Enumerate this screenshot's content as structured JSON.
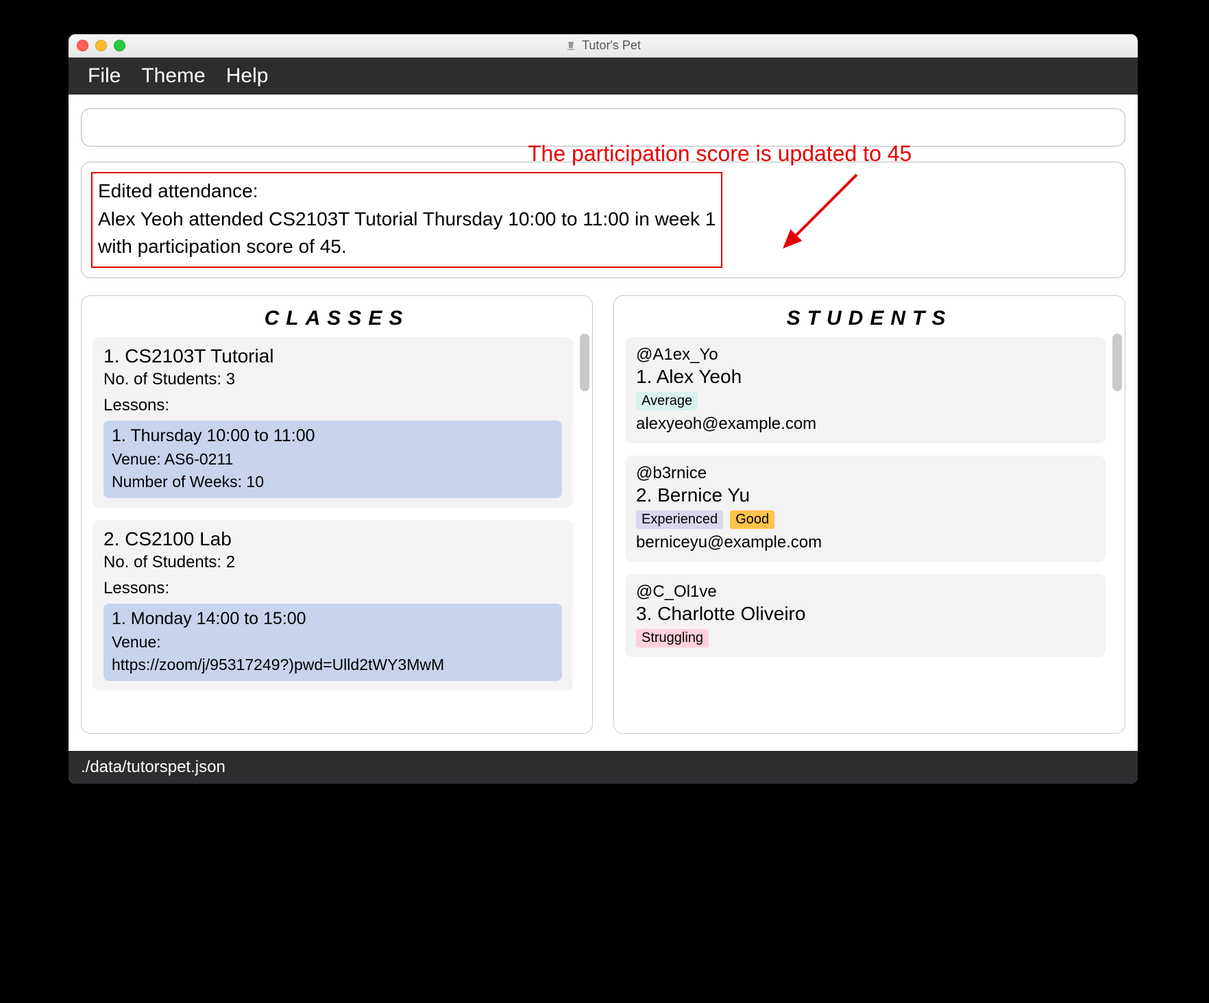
{
  "window": {
    "title": "Tutor's Pet"
  },
  "menubar": {
    "file": "File",
    "theme": "Theme",
    "help": "Help"
  },
  "command": {
    "value": ""
  },
  "result": {
    "line1": "Edited attendance:",
    "line2": "Alex Yeoh attended CS2103T Tutorial Thursday 10:00 to 11:00 in week 1",
    "line3": "with participation score of 45."
  },
  "annotation": {
    "text": "The participation score is updated to 45"
  },
  "panels": {
    "classes_header": "CLASSES",
    "students_header": "STUDENTS"
  },
  "classes": [
    {
      "title": "1.  CS2103T Tutorial",
      "students_line": "No. of Students:  3",
      "lessons_label": "Lessons:",
      "lessons": [
        {
          "time": "1. Thursday 10:00 to 11:00",
          "venue": "Venue: AS6-0211",
          "weeks": "Number of Weeks: 10"
        }
      ]
    },
    {
      "title": "2.  CS2100 Lab",
      "students_line": "No. of Students:  2",
      "lessons_label": "Lessons:",
      "lessons": [
        {
          "time": "1. Monday 14:00 to 15:00",
          "venue": "Venue:",
          "venue2": "https://zoom/j/95317249?)pwd=Ulld2tWY3MwM"
        }
      ]
    }
  ],
  "students": [
    {
      "handle": "@A1ex_Yo",
      "name": "1.  Alex Yeoh",
      "tags": [
        {
          "label": "Average",
          "cls": "tag-avg"
        }
      ],
      "email": "alexyeoh@example.com"
    },
    {
      "handle": "@b3rnice",
      "name": "2.  Bernice Yu",
      "tags": [
        {
          "label": "Experienced",
          "cls": "tag-exp"
        },
        {
          "label": "Good",
          "cls": "tag-good"
        }
      ],
      "email": "berniceyu@example.com"
    },
    {
      "handle": "@C_Ol1ve",
      "name": "3.  Charlotte Oliveiro",
      "tags": [
        {
          "label": "Struggling",
          "cls": "tag-strug"
        }
      ],
      "email": ""
    }
  ],
  "statusbar": {
    "path": "./data/tutorspet.json"
  }
}
